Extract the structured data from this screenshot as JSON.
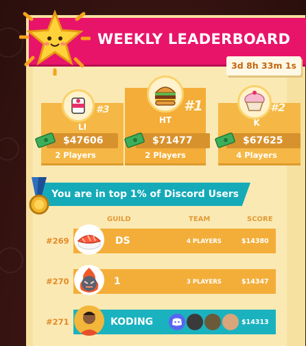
{
  "header": {
    "title": "WEEKLY LEADERBOARD",
    "timer": "3d 8h 33m 1s"
  },
  "podium": [
    {
      "place": "#3",
      "name": "LI",
      "amount": "$47606",
      "players": "2 Players",
      "icon": "sushi-roll-icon"
    },
    {
      "place": "#1",
      "name": "HT",
      "amount": "$71477",
      "players": "2 Players",
      "icon": "burger-icon"
    },
    {
      "place": "#2",
      "name": "K",
      "amount": "$67625",
      "players": "4 Players",
      "icon": "cupcake-icon"
    }
  ],
  "discord_banner": "You are in top 1% of Discord Users",
  "table": {
    "headers": {
      "guild": "GUILD",
      "team": "TEAM",
      "score": "SCORE"
    },
    "rows": [
      {
        "rank": "#269",
        "guild": "DS",
        "team": "4 PLAYERS",
        "score": "$14380",
        "icon": "salmon-sushi-icon"
      },
      {
        "rank": "#270",
        "guild": "1",
        "team": "3 PLAYERS",
        "score": "$14347",
        "icon": "angry-flame-icon"
      },
      {
        "rank": "#271",
        "guild": "KODING",
        "team": "",
        "score": "$14313",
        "icon": "user-photo-avatar"
      }
    ]
  },
  "colors": {
    "banner": "#e8146a",
    "card": "#f5b745",
    "discord": "#15aab8",
    "panel": "#f7e1a1"
  }
}
